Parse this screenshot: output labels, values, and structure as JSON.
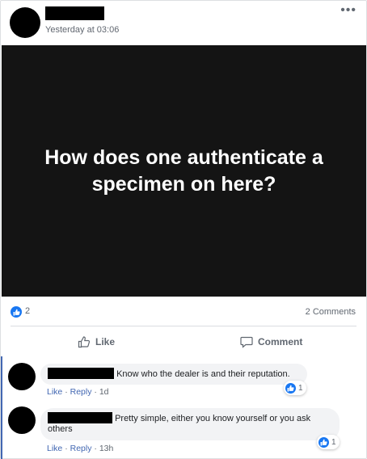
{
  "post": {
    "timestamp": "Yesterday at 03:06",
    "more_icon_text": "•••",
    "media_text": "How does one authenticate a specimen on here?",
    "reaction_count": "2",
    "comments_count": "2 Comments",
    "like_label": "Like",
    "comment_label": "Comment"
  },
  "comments": [
    {
      "text": "Know who the dealer is and their reputation.",
      "like": "Like",
      "reply": "Reply",
      "sep": "·",
      "time": "1d",
      "likes": "1"
    },
    {
      "text": "Pretty simple, either you know yourself or you ask others",
      "like": "Like",
      "reply": "Reply",
      "sep": "·",
      "time": "13h",
      "likes": "1"
    }
  ],
  "colors": {
    "accent": "#1877f2",
    "link": "#4267b2",
    "media_bg": "#141414"
  },
  "icons": {
    "like": "thumbs-up-icon",
    "comment": "speech-bubble-icon",
    "more": "more-options-icon"
  }
}
